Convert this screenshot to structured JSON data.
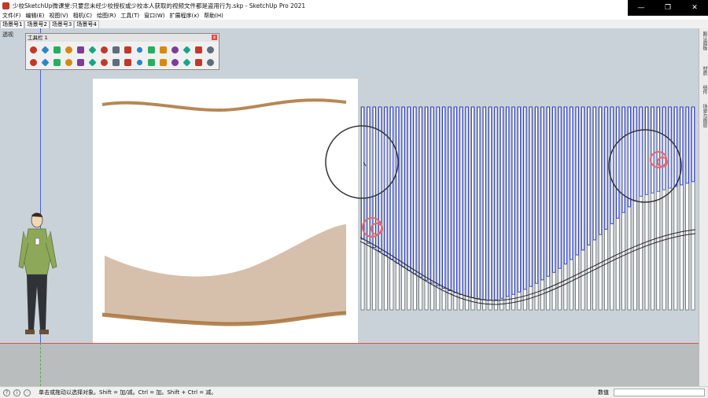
{
  "window": {
    "title": "少校SketchUp微课堂:只要您未经少校授权或少校本人获取的视频文件都是盗用行为.skp - SketchUp Pro 2021",
    "controls": [
      "—",
      "❐",
      "✕"
    ]
  },
  "menu": [
    "文件(F)",
    "编辑(E)",
    "视图(V)",
    "相机(C)",
    "绘图(R)",
    "工具(T)",
    "窗口(W)",
    "扩展程序(x)",
    "帮助(H)"
  ],
  "scene_tabs": [
    {
      "label": "场景号1",
      "active": false
    },
    {
      "label": "场景号2",
      "active": false
    },
    {
      "label": "场景号3",
      "active": true
    },
    {
      "label": "场景号4",
      "active": false
    }
  ],
  "viewport": {
    "view_label": "透视",
    "colors": {
      "sky": "#c9d2d8",
      "ground": "#b9bdbd",
      "red_axis": "#d9534f",
      "blue_axis": "#4a63d8",
      "slat_blue": "#2f3fd0",
      "wood": "#c9a173"
    }
  },
  "toolbar": {
    "title": "工具栏 1",
    "close": "x",
    "row1_icons": [
      "move-icon",
      "rotate-icon",
      "scale-icon",
      "follow-me-icon",
      "offset-icon",
      "paint-icon",
      "push-pull-icon",
      "solid-icon",
      "extrude-icon",
      "dimension-icon",
      "axes-icon",
      "protractor-icon",
      "shield-icon",
      "recycle-icon",
      "lock-icon",
      "magic-icon"
    ],
    "row2_icons": [
      "components-icon",
      "layers-icon",
      "arc-icon",
      "sandbox-icon",
      "terrain-icon",
      "smoove-icon",
      "stamp-icon",
      "drape-icon",
      "flip-icon",
      "curve-icon",
      "bend-icon",
      "section-icon",
      "zorro-icon",
      "paint-bucket-icon",
      "window-icon",
      "pin-icon"
    ]
  },
  "right_panel_tabs": [
    "默认面板",
    "材质",
    "组件",
    "场景与图层"
  ],
  "status": {
    "hint": "单击或拖动以选择对象。Shift = 加/减。Ctrl = 加。Shift + Ctrl = 减。",
    "value_label": "数值",
    "value": ""
  }
}
